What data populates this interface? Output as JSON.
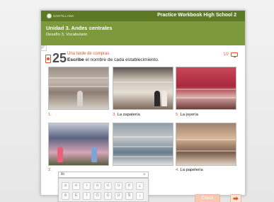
{
  "app": {
    "title": "Practice Workbook High School 2",
    "brand": "SANTILLANA"
  },
  "unit": {
    "title": "Unidad 3. Andes centrales",
    "subtitle": "Desafío 3, Vocabulario"
  },
  "activity": {
    "number": "25",
    "title": "Una tarde de compras",
    "instruction_bold": "Escribe",
    "instruction_rest": " el nombre de cada establecimiento.",
    "page_indicator": "1/2"
  },
  "items": [
    {
      "num": "1.",
      "answer": ""
    },
    {
      "num": "2.",
      "answer": ""
    },
    {
      "num": "3.",
      "answer": "La zapatería"
    },
    {
      "num": "4.",
      "answer": "La papelería"
    },
    {
      "num": "5.",
      "answer": "La joyería"
    }
  ],
  "answer_input": {
    "value": "lib"
  },
  "keyboard": {
    "row1": [
      "á",
      "é",
      "í",
      "ó",
      "ú",
      "ü",
      "ñ",
      "¿"
    ],
    "row2": [
      "Á",
      "É",
      "Í",
      "Ó",
      "Ú",
      "Ü",
      "Ñ",
      "¡"
    ],
    "close": "×"
  },
  "buttons": {
    "check": "Check",
    "next": "⮕"
  },
  "colors": {
    "header_dark": "#5c7a25",
    "header_light": "#7c993b",
    "accent": "#d9562e"
  },
  "icons": [
    "book-icon",
    "screen-icon",
    "close-icon",
    "arrow-icon"
  ]
}
